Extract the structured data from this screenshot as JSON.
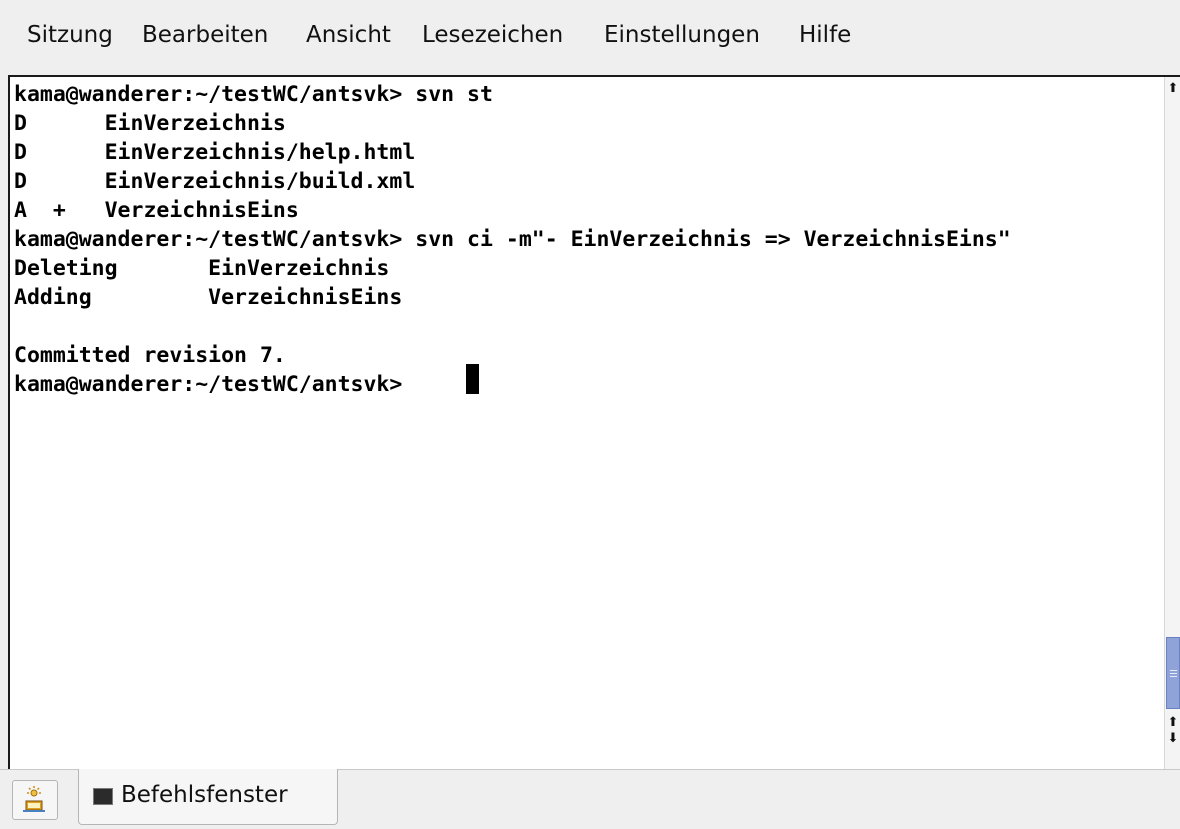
{
  "menubar": {
    "items": [
      {
        "label": "Sitzung"
      },
      {
        "label": "Bearbeiten"
      },
      {
        "label": "Ansicht"
      },
      {
        "label": "Lesezeichen"
      },
      {
        "label": "Einstellungen"
      },
      {
        "label": "Hilfe"
      }
    ]
  },
  "terminal": {
    "lines": [
      "kama@wanderer:~/testWC/antsvk> svn st",
      "D      EinVerzeichnis",
      "D      EinVerzeichnis/help.html",
      "D      EinVerzeichnis/build.xml",
      "A  +   VerzeichnisEins",
      "kama@wanderer:~/testWC/antsvk> svn ci -m\"- EinVerzeichnis => VerzeichnisEins\"",
      "Deleting       EinVerzeichnis",
      "Adding         VerzeichnisEins",
      "",
      "Committed revision 7.",
      "kama@wanderer:~/testWC/antsvk> "
    ]
  },
  "scrollbar": {
    "up_icon": "arrow-up-icon",
    "down_icon": "arrow-down-icon",
    "up_glyph": "⬆",
    "down_glyph": "⬇"
  },
  "tabbar": {
    "new_session_icon": "new-session-icon",
    "tab_label": "Befehlsfenster",
    "tab_icon": "terminal-icon"
  },
  "colors": {
    "terminal_bg": "#ffffff",
    "terminal_fg": "#000000",
    "scroll_thumb": "#8fa3d8"
  }
}
